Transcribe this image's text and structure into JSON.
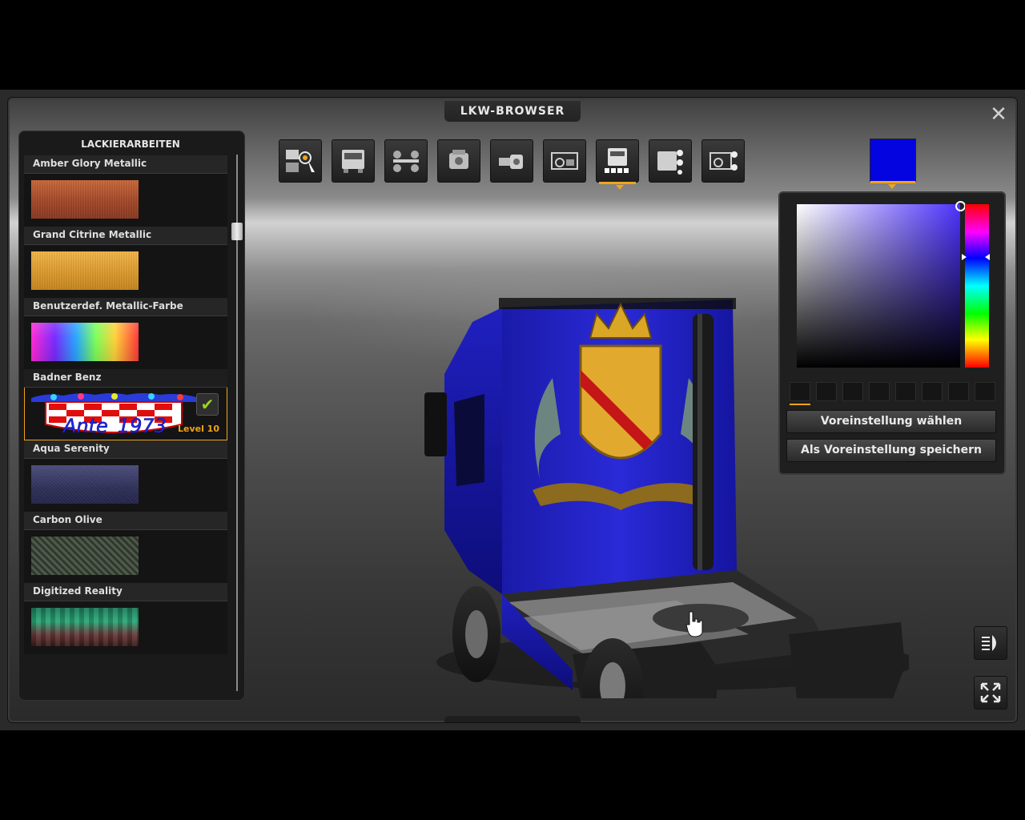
{
  "window": {
    "title": "LKW-BROWSER",
    "close_label": "✕"
  },
  "paint_panel": {
    "title": "LACKIERARBEITEN",
    "items": [
      {
        "label": "Amber Glory Metallic"
      },
      {
        "label": "Grand Citrine Metallic"
      },
      {
        "label": "Benutzerdef. Metallic-Farbe"
      },
      {
        "label": "Badner Benz",
        "selected": true,
        "level": "Level 10",
        "check": "✔",
        "flag_text": "Ante_1973"
      },
      {
        "label": "Aqua Serenity"
      },
      {
        "label": "Carbon Olive"
      },
      {
        "label": "Digitized Reality"
      }
    ]
  },
  "toolbar": {
    "active_index": 6,
    "buttons": [
      {
        "icon": "truck-search-icon"
      },
      {
        "icon": "truck-cab-icon"
      },
      {
        "icon": "chassis-icon"
      },
      {
        "icon": "engine-icon"
      },
      {
        "icon": "transmission-icon"
      },
      {
        "icon": "interior-icon"
      },
      {
        "icon": "paint-job-icon"
      },
      {
        "icon": "accessories-icon"
      },
      {
        "icon": "interior-accessories-icon"
      }
    ]
  },
  "color_picker": {
    "current_color": "#0404e0",
    "preset_button": "Voreinstellung wählen",
    "save_button": "Als Voreinstellung speichern",
    "accent_color": "#f0a41a"
  },
  "side_buttons": {
    "lights_icon": "headlight-icon",
    "fullscreen_icon": "fullscreen-icon"
  }
}
